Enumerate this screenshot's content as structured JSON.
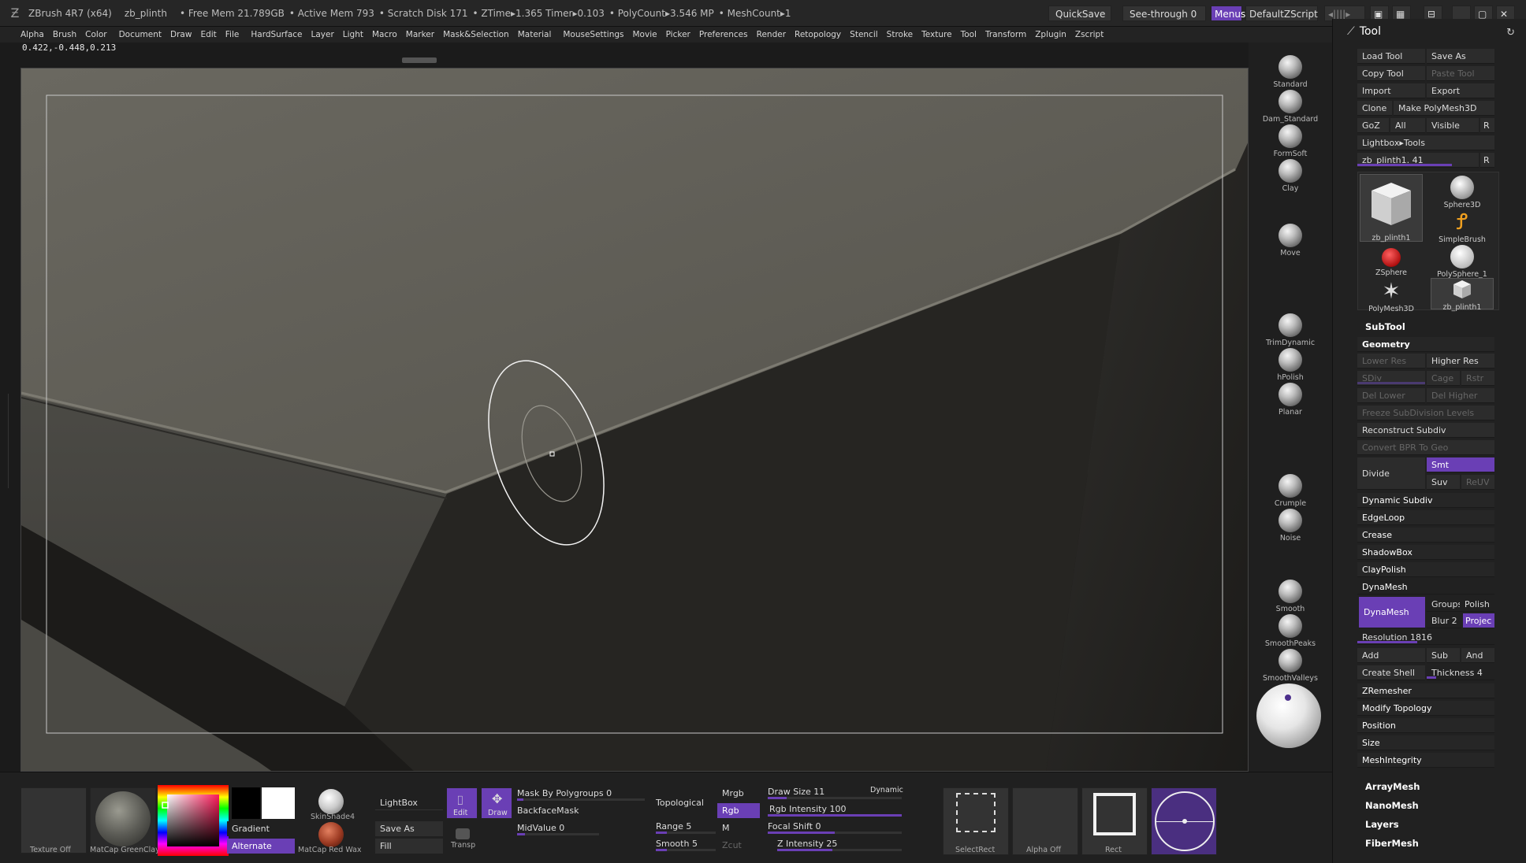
{
  "title": {
    "app": "ZBrush 4R7 (x64)",
    "tool": "zb_plinth",
    "free_mem": "• Free Mem 21.789GB",
    "active_mem": "• Active Mem 793",
    "scratch_disk": "• Scratch Disk 171",
    "ztime": "• ZTime▸1.365 Timer▸0.103",
    "polycount": "• PolyCount▸3.546 MP",
    "meshcount": "• MeshCount▸1",
    "quicksave": "QuickSave",
    "see_through": "See-through  0",
    "menus": "Menus",
    "script": "DefaultZScript"
  },
  "menu": [
    "Alpha",
    "Brush",
    "Color",
    "Document",
    "Draw",
    "Edit",
    "File",
    "HardSurface",
    "Layer",
    "Light",
    "Macro",
    "Marker",
    "Mask&Selection",
    "Material",
    "MouseSettings",
    "Movie",
    "Picker",
    "Preferences",
    "Render",
    "Retopology",
    "Stencil",
    "Stroke",
    "Texture",
    "Tool",
    "Transform",
    "Zplugin",
    "Zscript"
  ],
  "coords": "0.422,-0.448,0.213",
  "brushes": [
    "Standard",
    "Dam_Standard",
    "FormSoft",
    "Clay",
    "Move",
    "TrimDynamic",
    "hPolish",
    "Planar",
    "Crumple",
    "Noise",
    "Smooth",
    "SmoothPeaks",
    "SmoothValleys"
  ],
  "panel": {
    "title": "Tool",
    "load_tool": "Load Tool",
    "save_as": "Save As",
    "copy_tool": "Copy Tool",
    "paste_tool": "Paste Tool",
    "import": "Import",
    "export": "Export",
    "clone": "Clone",
    "make_polymesh": "Make PolyMesh3D",
    "goz": "GoZ",
    "all": "All",
    "visible": "Visible",
    "r": "R",
    "lightbox_tools": "Lightbox▸Tools",
    "current_tool": "zb_plinth1. 41",
    "tools": [
      "zb_plinth1",
      "Sphere3D",
      "SimpleBrush",
      "ZSphere",
      "PolySphere_1",
      "PolyMesh3D",
      "zb_plinth1"
    ],
    "subtool": "SubTool",
    "geometry": "Geometry",
    "lower_res": "Lower Res",
    "higher_res": "Higher Res",
    "sdiv": "SDiv",
    "cage": "Cage",
    "rstr": "Rstr",
    "del_lower": "Del Lower",
    "del_higher": "Del Higher",
    "freeze": "Freeze SubDivision Levels",
    "reconstruct": "Reconstruct Subdiv",
    "convert_bpr": "Convert BPR To Geo",
    "divide": "Divide",
    "smt": "Smt",
    "suv": "Suv",
    "reuv": "ReUV",
    "dynamic_subdiv": "Dynamic Subdiv",
    "edgeloop": "EdgeLoop",
    "crease": "Crease",
    "shadowbox": "ShadowBox",
    "claypolish": "ClayPolish",
    "dynamesh_header": "DynaMesh",
    "dynamesh_btn": "DynaMesh",
    "groups": "Groups",
    "polish": "Polish",
    "blur": "Blur 2",
    "project": "Projec",
    "resolution": "Resolution 1816",
    "add": "Add",
    "sub": "Sub",
    "and": "And",
    "create_shell": "Create Shell",
    "thickness": "Thickness 4",
    "zremesher": "ZRemesher",
    "modify_topology": "Modify Topology",
    "position": "Position",
    "size": "Size",
    "meshintegrity": "MeshIntegrity",
    "arraymesh": "ArrayMesh",
    "nanomesh": "NanoMesh",
    "layers": "Layers",
    "fibermesh": "FiberMesh"
  },
  "bottom": {
    "texture": "Texture Off",
    "matcap": "MatCap GreenClay",
    "gradient": "Gradient",
    "alternate": "Alternate",
    "skinshade": "SkinShade4",
    "matcap_red": "MatCap Red Wax",
    "lightbox": "LightBox",
    "save_as": "Save As",
    "fill": "Fill",
    "transp": "Transp",
    "edit": "Edit",
    "draw": "Draw",
    "mask_polygroups": "Mask By Polygroups 0",
    "backface": "BackfaceMask",
    "midvalue": "MidValue 0",
    "topological": "Topological",
    "range": "Range 5",
    "smooth": "Smooth 5",
    "mrgb": "Mrgb",
    "rgb": "Rgb",
    "m": "M",
    "zcut": "Zcut",
    "draw_size": "Draw Size 11",
    "dynamic": "Dynamic",
    "rgb_intensity": "Rgb Intensity 100",
    "focal_shift": "Focal Shift 0",
    "z_intensity": "Z Intensity 25",
    "selectrect": "SelectRect",
    "alpha_off": "Alpha Off",
    "rect": "Rect"
  }
}
